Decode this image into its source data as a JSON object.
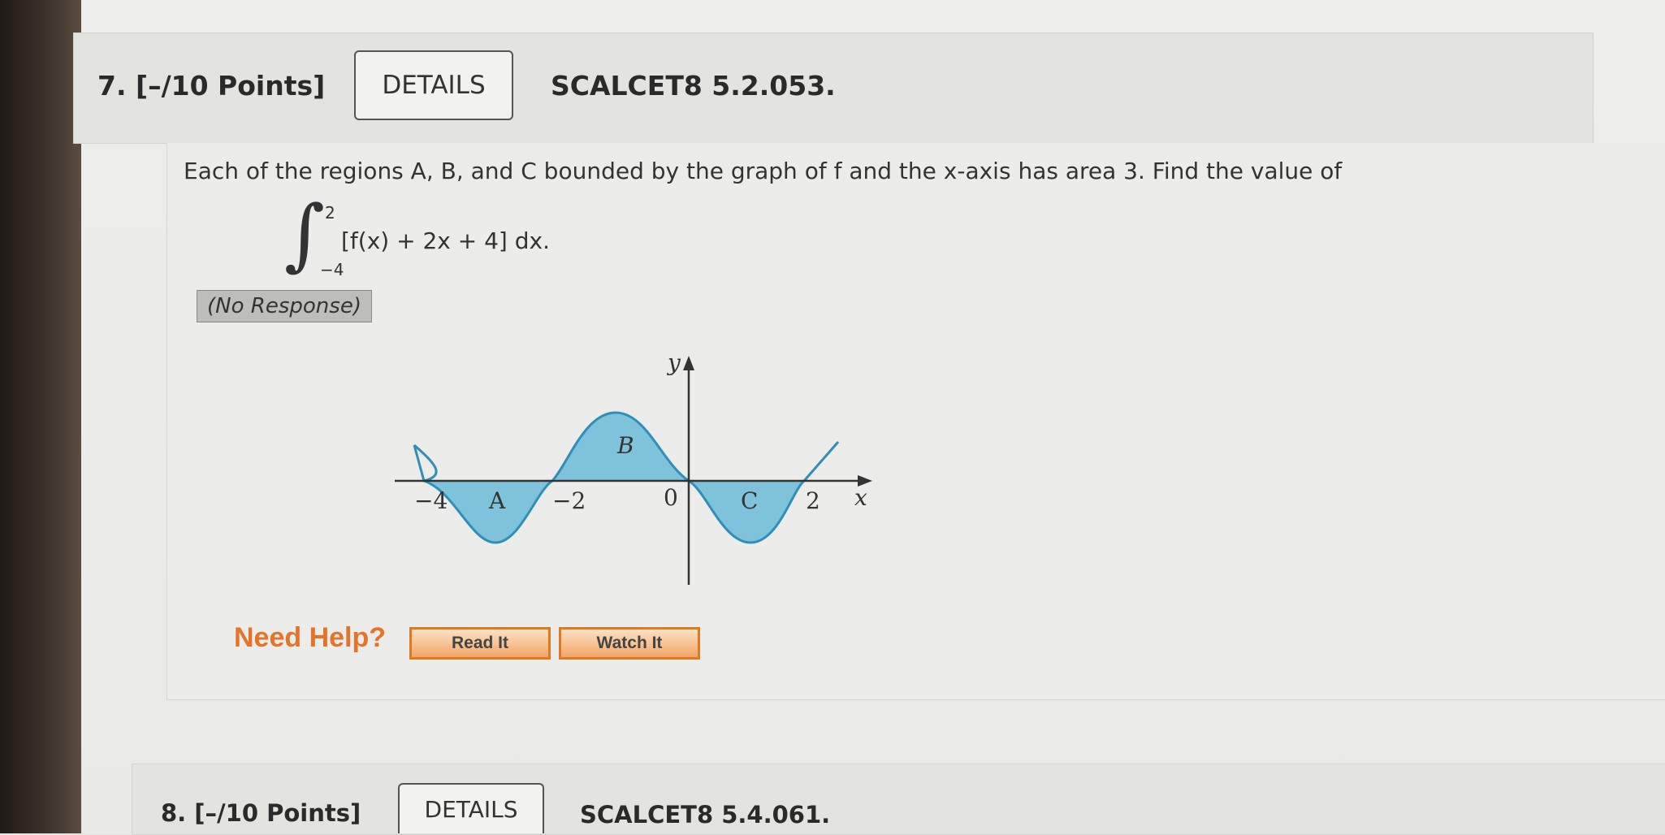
{
  "question7": {
    "number": "7. [–/10 Points]",
    "details_label": "DETAILS",
    "code": "SCALCET8 5.2.053.",
    "prompt": "Each of the regions A, B, and C bounded by the graph of f and the x-axis has area 3. Find the value of",
    "integral": {
      "upper": "2",
      "lower": "−4",
      "integrand": "[f(x) + 2x + 4] dx."
    },
    "response": "(No Response)",
    "graph": {
      "y_axis_label": "y",
      "x_axis_label": "x",
      "ticks": [
        "−4",
        "−2",
        "0",
        "2"
      ],
      "regions": [
        "A",
        "B",
        "C"
      ],
      "fill_color": "#7ec3db",
      "curve_color": "#2f8fb8"
    },
    "help": {
      "label": "Need Help?",
      "read_it": "Read It",
      "watch_it": "Watch It",
      "accent": "#e4742a"
    }
  },
  "question8": {
    "number": "8. [–/10 Points]",
    "details_label": "DETAILS",
    "code": "SCALCET8 5.4.061."
  }
}
